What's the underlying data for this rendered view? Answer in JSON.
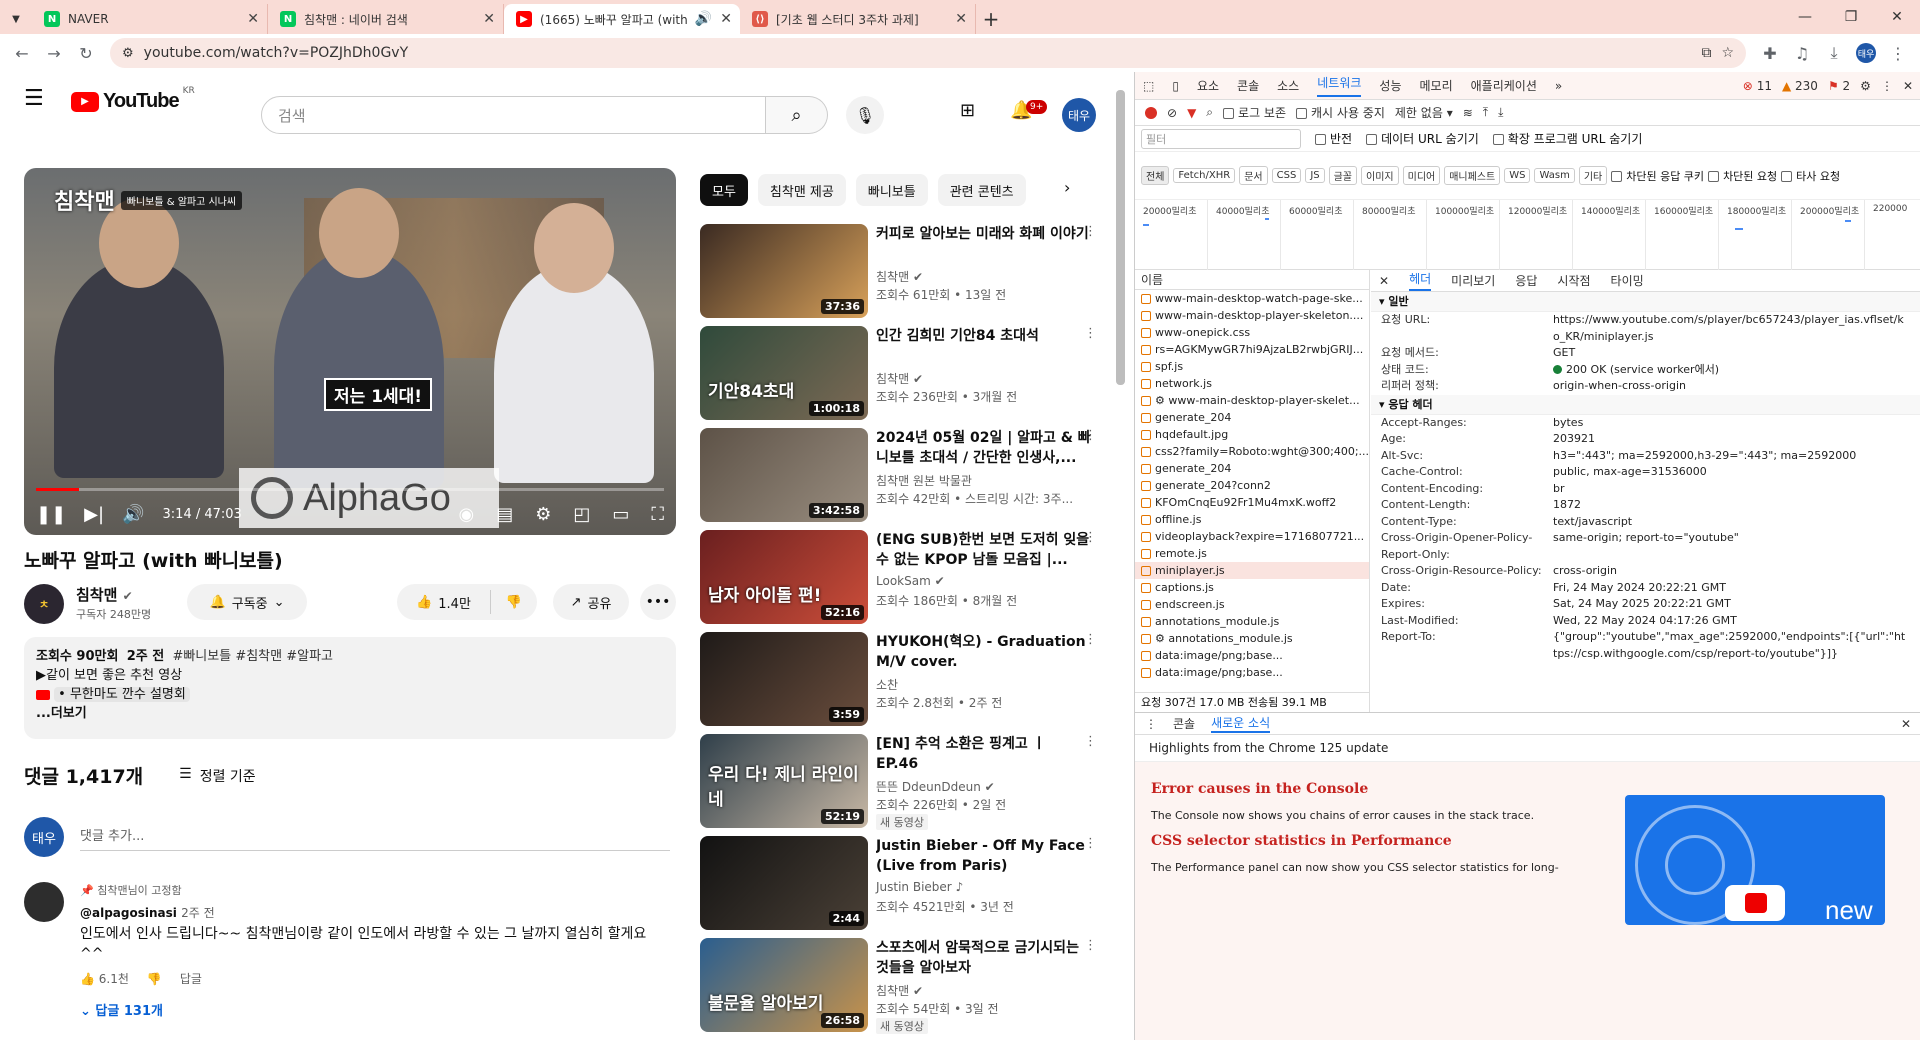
{
  "browser": {
    "tabs": [
      {
        "title": "NAVER",
        "icon": "naver-favicon",
        "color": "#03c75a"
      },
      {
        "title": "침착맨 : 네이버 검색",
        "icon": "naver-favicon",
        "color": "#03c75a"
      },
      {
        "title": "(1665) 노빠꾸 알파고 (with",
        "icon": "youtube-favicon",
        "color": "#ff0000",
        "active": true
      },
      {
        "title": "[기초 웹 스터디 3주차 과제]",
        "icon": "code-favicon",
        "color": "#e0594a"
      }
    ],
    "url": "youtube.com/watch?v=POZJhDh0GvY",
    "profile_initial": "태우"
  },
  "youtube": {
    "logo_text": "YouTube",
    "region": "KR",
    "search_placeholder": "검색",
    "notif_count": "9+",
    "avatar": "태우",
    "player": {
      "channel_mark": "침착맨",
      "series_tag": "빠니보틀 & 알파고 시나씨",
      "caption": "저는 1세대!",
      "alphago": "AlphaGo",
      "time": "3:14 / 47:03",
      "progress": 0.068
    },
    "video": {
      "title": "노빠꾸 알파고 (with 빠니보틀)",
      "channel": "침착맨",
      "subscribers": "구독자 248만명",
      "subscribe_label": "구독중",
      "likes": "1.4만",
      "share_label": "공유"
    },
    "description": {
      "views": "조회수 90만회",
      "ago": "2주 전",
      "hashtags": "#빠니보틀 #침착맨 #알파고",
      "line2": "▶같이 보면 좋은 추천 영상",
      "line3": "• 무한마도 깐수 설명회",
      "more": "...더보기"
    },
    "comments": {
      "count": "댓글 1,417개",
      "sort": "정렬 기준",
      "add_placeholder": "댓글 추가...",
      "add_avatar": "태우",
      "pinned_by": "침착맨님이 고정함",
      "handle": "@alpagosinasi",
      "ago": "2주 전",
      "text": "인도에서 인사 드립니다~~ 침착맨님이랑 같이 인도에서 라방할 수 있는 그 날까지 열심히 할게요 ^^",
      "likes": "6.1천",
      "reply_label": "답글",
      "replies": "답글 131개"
    },
    "chips": [
      "모두",
      "침착맨 제공",
      "빠니보틀",
      "관련 콘텐츠"
    ],
    "recs": [
      {
        "title": "커피로 알아보는 미래와 화폐 이야기",
        "channel": "침착맨",
        "meta": "조회수 61만회 • 13일 전",
        "dur": "37:36",
        "c1": "#3a2a22",
        "c2": "#d8a15a",
        "verified": true
      },
      {
        "title": "인간 김희민 기안84 초대석",
        "channel": "침착맨",
        "meta": "조회수 236만회 • 3개월 전",
        "dur": "1:00:18",
        "c1": "#2f4a3b",
        "c2": "#7d6a55",
        "overlay": "기안84초대",
        "verified": true
      },
      {
        "title": "2024년 05월 02일 | 알파고 & 빠니보틀 초대석 / 간단한 인생사,...",
        "channel": "침착맨 원본 박물관",
        "meta": "조회수 42만회 • 스트리밍 시간: 3주...",
        "dur": "3:42:58",
        "c1": "#5d5247",
        "c2": "#9a8e80"
      },
      {
        "title": "(ENG SUB)한번 보면 도저히 잊을 수 없는 KPOP 남돌 모음집 |...",
        "channel": "LookSam",
        "meta": "조회수 186만회 • 8개월 전",
        "dur": "52:16",
        "c1": "#6a1f1f",
        "c2": "#cc4e3a",
        "overlay": "남자 아이돌 편!",
        "verified": true
      },
      {
        "title": "HYUKOH(혁오) - Graduation M/V cover.",
        "channel": "소찬",
        "meta": "조회수 2.8천회 • 2주 전",
        "dur": "3:59",
        "c1": "#1e1a18",
        "c2": "#6b4e3d"
      },
      {
        "title": "[EN] 추억 소환은 핑계고 ㅣ EP.46",
        "channel": "뜬뜬 DdeunDdeun",
        "meta": "조회수 226만회 • 2일 전",
        "dur": "52:19",
        "c1": "#2f3f4a",
        "c2": "#c8b8a5",
        "overlay": "우리 다! 제니 라인이네",
        "new": "새 동영상",
        "verified": true
      },
      {
        "title": "Justin Bieber - Off My Face (Live from Paris)",
        "channel": "Justin Bieber",
        "meta": "조회수 4521만회 • 3년 전",
        "dur": "2:44",
        "c1": "#121212",
        "c2": "#4a4036",
        "music": true
      },
      {
        "title": "스포츠에서 암묵적으로 금기시되는 것들을 알아보자",
        "channel": "침착맨",
        "meta": "조회수 54만회 • 3일 전",
        "dur": "26:58",
        "c1": "#2a5e8f",
        "c2": "#c9934a",
        "overlay": "불문율 알아보기",
        "new": "새 동영상",
        "verified": true
      }
    ]
  },
  "devtools": {
    "tabs": [
      "요소",
      "콘솔",
      "소스",
      "네트워크",
      "성능",
      "메모리",
      "애플리케이션"
    ],
    "active_tab": "네트워크",
    "errors": "11",
    "warnings": "230",
    "issues": "2",
    "toolbar": {
      "preserve_log": "로그 보존",
      "disable_cache": "캐시 사용 중지",
      "throttle": "제한 없음"
    },
    "filter_placeholder": "필터",
    "invert": "반전",
    "hide_data_urls": "데이터 URL 숨기기",
    "hide_ext_urls": "확장 프로그램 URL 숨기기",
    "types": [
      "전체",
      "Fetch/XHR",
      "문서",
      "CSS",
      "JS",
      "글꼴",
      "이미지",
      "미디어",
      "매니페스트",
      "WS",
      "Wasm",
      "기타"
    ],
    "blocked_cookies": "차단된 응답 쿠키",
    "blocked_requests": "차단된 요청",
    "third_party": "타사 요청",
    "timeline_ticks": [
      "20000밀리초",
      "40000밀리초",
      "60000밀리초",
      "80000밀리초",
      "100000밀리초",
      "120000밀리초",
      "140000밀리초",
      "160000밀리초",
      "180000밀리초",
      "200000밀리초",
      "220000"
    ],
    "name_header": "이름",
    "requests": [
      "www-main-desktop-watch-page-ske...",
      "www-main-desktop-player-skeleton....",
      "www-onepick.css",
      "rs=AGKMywGR7hi9AjzaLB2rwbjGRIJ...",
      "spf.js",
      "network.js",
      "⚙ www-main-desktop-player-skelet...",
      "generate_204",
      "hqdefault.jpg",
      "css2?family=Roboto:wght@300;400;...",
      "generate_204",
      "generate_204?conn2",
      "KFOmCnqEu92Fr1Mu4mxK.woff2",
      "offline.js",
      "videoplayback?expire=1716807721...",
      "remote.js",
      "miniplayer.js",
      "captions.js",
      "endscreen.js",
      "annotations_module.js",
      "⚙ annotations_module.js",
      "data:image/png;base...",
      "data:image/png;base..."
    ],
    "selected_request": 16,
    "footer": "요청 307건    17.0 MB 전송됨    39.1 MB",
    "detail_tabs": [
      "헤더",
      "미리보기",
      "응답",
      "시작점",
      "타이밍"
    ],
    "general_title": "일반",
    "general": [
      {
        "k": "요청 URL:",
        "v": "https://www.youtube.com/s/player/bc657243/player_ias.vflset/ko_KR/miniplayer.js"
      },
      {
        "k": "요청 메서드:",
        "v": "GET"
      },
      {
        "k": "상태 코드:",
        "v": "200 OK (service worker에서)",
        "status": true
      },
      {
        "k": "리퍼러 정책:",
        "v": "origin-when-cross-origin"
      }
    ],
    "response_title": "응답 헤더",
    "response": [
      {
        "k": "Accept-Ranges:",
        "v": "bytes"
      },
      {
        "k": "Age:",
        "v": "203921"
      },
      {
        "k": "Alt-Svc:",
        "v": "h3=\":443\"; ma=2592000,h3-29=\":443\"; ma=2592000"
      },
      {
        "k": "Cache-Control:",
        "v": "public, max-age=31536000"
      },
      {
        "k": "Content-Encoding:",
        "v": "br"
      },
      {
        "k": "Content-Length:",
        "v": "1872"
      },
      {
        "k": "Content-Type:",
        "v": "text/javascript"
      },
      {
        "k": "Cross-Origin-Opener-Policy-Report-Only:",
        "v": "same-origin; report-to=\"youtube\""
      },
      {
        "k": "Cross-Origin-Resource-Policy:",
        "v": "cross-origin"
      },
      {
        "k": "Date:",
        "v": "Fri, 24 May 2024 20:22:21 GMT"
      },
      {
        "k": "Expires:",
        "v": "Sat, 24 May 2025 20:22:21 GMT"
      },
      {
        "k": "Last-Modified:",
        "v": "Wed, 22 May 2024 04:17:26 GMT"
      },
      {
        "k": "Report-To:",
        "v": "{\"group\":\"youtube\",\"max_age\":2592000,\"endpoints\":[{\"url\":\"https://csp.withgoogle.com/csp/report-to/youtube\"}]}"
      }
    ],
    "drawer": {
      "tabs": [
        "콘솔",
        "새로운 소식"
      ],
      "active": "새로운 소식",
      "headline": "Highlights from the Chrome 125 update",
      "items": [
        {
          "title": "Error causes in the Console",
          "body": "The Console now shows you chains of error causes in the stack trace."
        },
        {
          "title": "CSS selector statistics in Performance",
          "body": "The Performance panel can now show you CSS selector statistics for long-"
        }
      ],
      "image_label": "new"
    }
  }
}
